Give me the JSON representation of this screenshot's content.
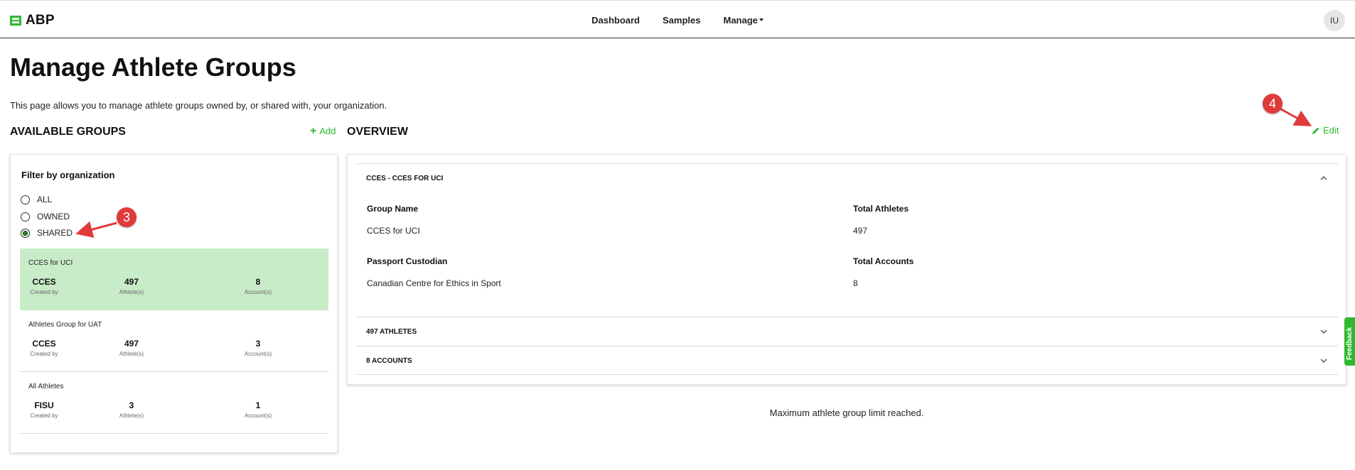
{
  "brand": {
    "name": "ABP"
  },
  "nav": {
    "items": [
      "Dashboard",
      "Samples",
      "Manage"
    ]
  },
  "user": {
    "initials": "IU"
  },
  "page": {
    "title": "Manage Athlete Groups",
    "description": "This page allows you to manage athlete groups owned by, or shared with, your organization."
  },
  "left": {
    "title": "AVAILABLE GROUPS",
    "add_label": "Add",
    "filter_title": "Filter by organization",
    "filters": [
      {
        "label": "ALL",
        "checked": false
      },
      {
        "label": "OWNED",
        "checked": false
      },
      {
        "label": "SHARED",
        "checked": true
      }
    ],
    "groups": [
      {
        "name": "CCES for UCI",
        "created_by": "CCES",
        "created_by_label": "Created by",
        "athletes": "497",
        "athletes_label": "Athlete(s)",
        "accounts": "8",
        "accounts_label": "Account(s)",
        "selected": true
      },
      {
        "name": "Athletes Group for UAT",
        "created_by": "CCES",
        "created_by_label": "Created by",
        "athletes": "497",
        "athletes_label": "Athlete(s)",
        "accounts": "3",
        "accounts_label": "Account(s)",
        "selected": false
      },
      {
        "name": "All Athletes",
        "created_by": "FISU",
        "created_by_label": "Created by",
        "athletes": "3",
        "athletes_label": "Athlete(s)",
        "accounts": "1",
        "accounts_label": "Account(s)",
        "selected": false
      }
    ]
  },
  "right": {
    "title": "OVERVIEW",
    "edit_label": "Edit",
    "sections": [
      {
        "title": "CCES - CCES FOR UCI",
        "expanded": true
      },
      {
        "title": "497 ATHLETES",
        "expanded": false
      },
      {
        "title": "8 ACCOUNTS",
        "expanded": false
      }
    ],
    "fields": {
      "group_name_label": "Group Name",
      "group_name_value": "CCES for UCI",
      "total_athletes_label": "Total Athletes",
      "total_athletes_value": "497",
      "custodian_label": "Passport Custodian",
      "custodian_value": "Canadian Centre for Ethics in Sport",
      "total_accounts_label": "Total Accounts",
      "total_accounts_value": "8"
    },
    "limit_message": "Maximum athlete group limit reached."
  },
  "annotations": {
    "markers": [
      "3",
      "4"
    ],
    "color": "#e03b3b"
  },
  "feedback": {
    "label": "Feedback"
  },
  "colors": {
    "accent": "#2eb82e",
    "selected_bg": "#c8ebc8"
  }
}
